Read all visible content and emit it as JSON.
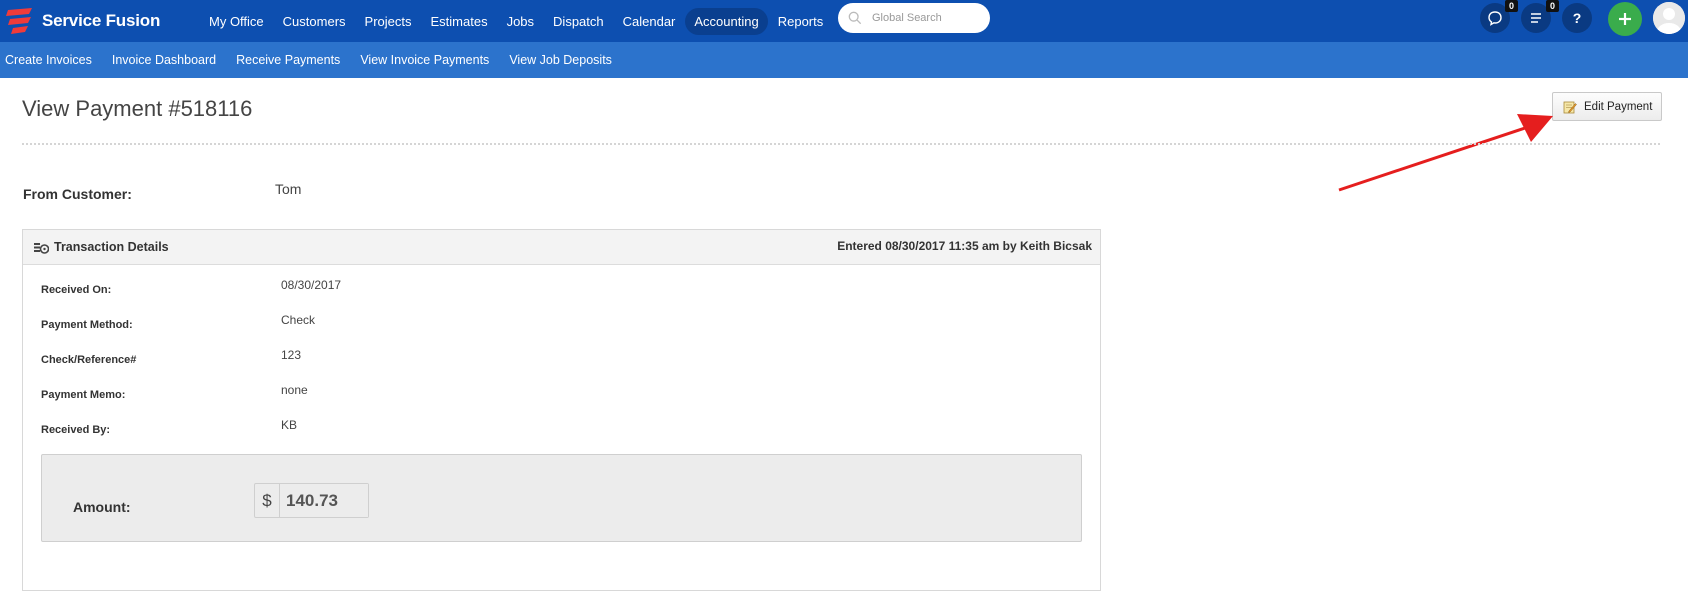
{
  "app": {
    "brand": "Service Fusion",
    "brand_color": "#0d4fb0",
    "subnav_color": "#2c73cc",
    "accent_green": "#3aac4c",
    "annotation_arrow_color": "#e51e1e"
  },
  "nav": {
    "items": [
      {
        "label": "My Office"
      },
      {
        "label": "Customers"
      },
      {
        "label": "Projects"
      },
      {
        "label": "Estimates"
      },
      {
        "label": "Jobs"
      },
      {
        "label": "Dispatch"
      },
      {
        "label": "Calendar"
      },
      {
        "label": "Accounting",
        "active": true
      },
      {
        "label": "Reports"
      }
    ],
    "search": {
      "placeholder": "Global Search",
      "value": ""
    },
    "chat_count": "0",
    "tasks_count": "0",
    "help_label": "?"
  },
  "subnav": {
    "items": [
      {
        "label": "Create Invoices"
      },
      {
        "label": "Invoice Dashboard"
      },
      {
        "label": "Receive Payments"
      },
      {
        "label": "View Invoice Payments",
        "active": true
      },
      {
        "label": "View Job Deposits"
      }
    ]
  },
  "page": {
    "title": "View Payment #518116",
    "edit_button": "Edit Payment",
    "from_customer_label": "From Customer:",
    "from_customer_value": "Tom"
  },
  "transaction": {
    "title": "Transaction Details",
    "entered": "Entered 08/30/2017 11:35 am by Keith Bicsak",
    "fields": [
      {
        "label": "Received On:",
        "value": "08/30/2017"
      },
      {
        "label": "Payment Method:",
        "value": "Check"
      },
      {
        "label": "Check/Reference#",
        "value": "123"
      },
      {
        "label": "Payment Memo:",
        "value": "none"
      },
      {
        "label": "Received By:",
        "value": "KB"
      }
    ],
    "amount_label": "Amount:",
    "currency_symbol": "$",
    "amount_value": "140.73"
  },
  "icons": [
    "logo-icon",
    "search-icon",
    "chat-icon",
    "tasks-icon",
    "help-icon",
    "plus-icon",
    "avatar-icon",
    "edit-icon",
    "coins-icon",
    "annotation-arrow"
  ]
}
